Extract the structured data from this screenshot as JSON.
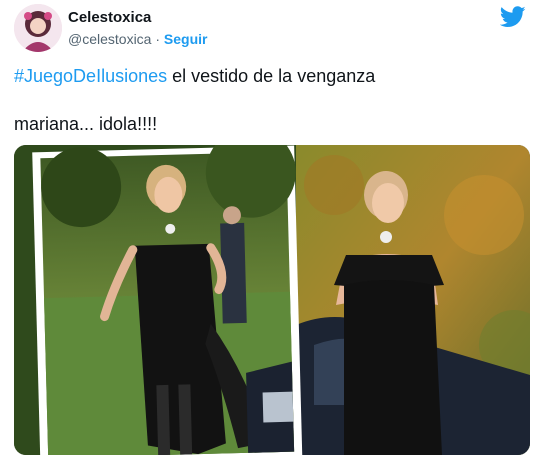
{
  "author": {
    "display_name": "Celestoxica",
    "handle": "@celestoxica",
    "separator": " · ",
    "follow_label": "Seguir"
  },
  "tweet": {
    "hashtag": "#JuegoDeIlusiones",
    "line1_rest": " el vestido de la venganza",
    "line2": "mariana... idola!!!!"
  },
  "colors": {
    "accent": "#1d9bf0",
    "text": "#0f1419",
    "secondary": "#536471"
  },
  "icons": {
    "brand": "twitter-bird-icon"
  }
}
